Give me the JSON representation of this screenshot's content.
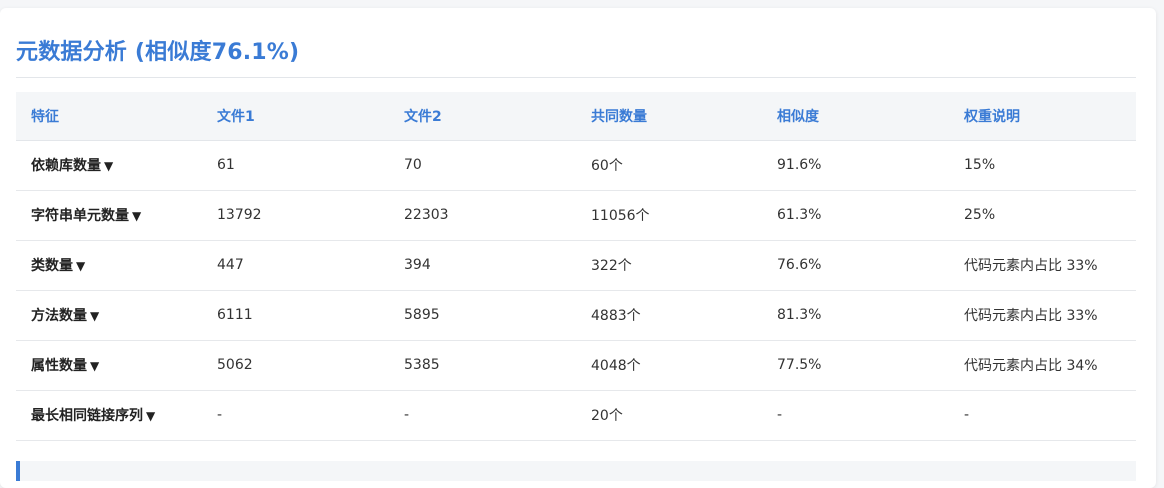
{
  "title": "元数据分析 (相似度76.1%)",
  "colors": {
    "accent": "#3a7bd5",
    "header_bg": "#f4f6f8"
  },
  "table": {
    "headers": [
      "特征",
      "文件1",
      "文件2",
      "共同数量",
      "相似度",
      "权重说明"
    ],
    "rows": [
      {
        "feature": "依赖库数量",
        "file1": "61",
        "file2": "70",
        "common": "60个",
        "similarity": "91.6%",
        "weight": "15%"
      },
      {
        "feature": "字符串单元数量",
        "file1": "13792",
        "file2": "22303",
        "common": "11056个",
        "similarity": "61.3%",
        "weight": "25%"
      },
      {
        "feature": "类数量",
        "file1": "447",
        "file2": "394",
        "common": "322个",
        "similarity": "76.6%",
        "weight": "代码元素内占比 33%"
      },
      {
        "feature": "方法数量",
        "file1": "6111",
        "file2": "5895",
        "common": "4883个",
        "similarity": "81.3%",
        "weight": "代码元素内占比 33%"
      },
      {
        "feature": "属性数量",
        "file1": "5062",
        "file2": "5385",
        "common": "4048个",
        "similarity": "77.5%",
        "weight": "代码元素内占比 34%"
      },
      {
        "feature": "最长相同链接序列",
        "file1": "-",
        "file2": "-",
        "common": "20个",
        "similarity": "-",
        "weight": "-"
      }
    ],
    "expand_icon": "triangle-down-icon",
    "expand_glyph": "▼"
  }
}
